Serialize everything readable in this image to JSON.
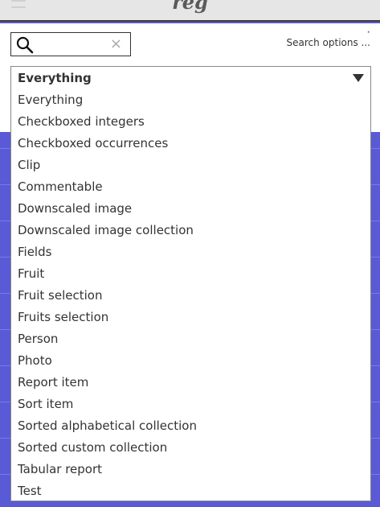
{
  "app": {
    "title": "reg"
  },
  "search": {
    "value": "",
    "placeholder": "",
    "clear_symbol": "×",
    "options_label": "Search options ...",
    "options_marker": "˟"
  },
  "type_select": {
    "selected": "Everything",
    "options": [
      "Everything",
      "Checkboxed integers",
      "Checkboxed occurrences",
      "Clip",
      "Commentable",
      "Downscaled image",
      "Downscaled image collection",
      "Fields",
      "Fruit",
      "Fruit selection",
      "Fruits selection",
      "Person",
      "Photo",
      "Report item",
      "Sort item",
      "Sorted alphabetical collection",
      "Sorted custom collection",
      "Tabular report",
      "Test"
    ]
  },
  "colors": {
    "content_background": "#5a5ad6",
    "topbar_background": "#e6e6e6"
  }
}
